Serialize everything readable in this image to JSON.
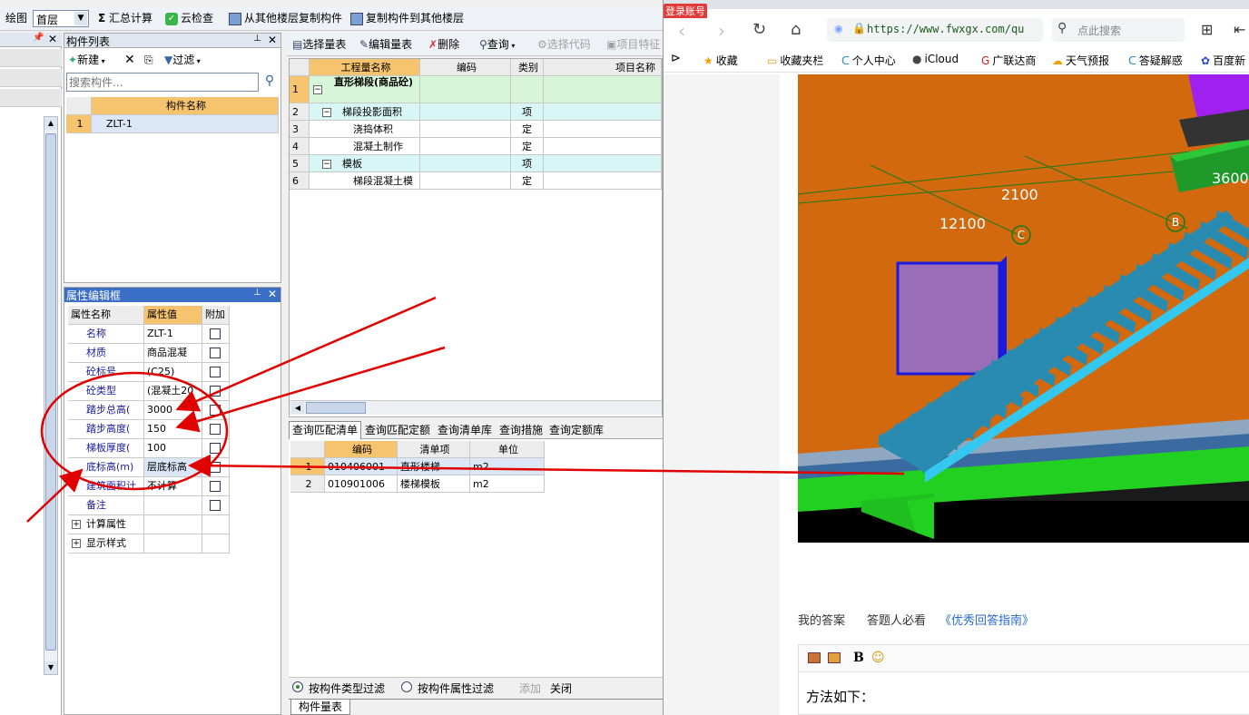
{
  "toolbar": {
    "draw_label": "绘图",
    "floor_value": "首层",
    "summary_calc": "汇总计算",
    "cloud_check": "云检查",
    "copy_from_floor": "从其他楼层复制构件",
    "copy_to_floor": "复制构件到其他楼层"
  },
  "component_list": {
    "title": "构件列表",
    "new_label": "新建",
    "filter_label": "过滤",
    "search_placeholder": "搜索构件...",
    "col_name": "构件名称",
    "rows": [
      {
        "idx": "1",
        "name": "ZLT-1"
      }
    ]
  },
  "property_editor": {
    "title": "属性编辑框",
    "col_name": "属性名称",
    "col_value": "属性值",
    "col_extra": "附加",
    "rows": [
      {
        "name": "名称",
        "value": "ZLT-1"
      },
      {
        "name": "材质",
        "value": "商品混凝"
      },
      {
        "name": "砼标号",
        "value": "(C25)"
      },
      {
        "name": "砼类型",
        "value": "(混凝土20"
      },
      {
        "name": "踏步总高(",
        "value": "3000"
      },
      {
        "name": "踏步高度(",
        "value": "150"
      },
      {
        "name": "梯板厚度(",
        "value": "100"
      },
      {
        "name": "底标高(m)",
        "value": "层底标高"
      },
      {
        "name": "建筑面积计",
        "value": "不计算"
      },
      {
        "name": "备注",
        "value": ""
      },
      {
        "name": "计算属性",
        "value": ""
      },
      {
        "name": "显示样式",
        "value": ""
      }
    ]
  },
  "quantity_toolbar": {
    "select_list": "选择量表",
    "edit_list": "编辑量表",
    "delete": "删除",
    "query": "查询",
    "select_code": "选择代码",
    "item_feature": "项目特征"
  },
  "quantity_table": {
    "cols": [
      "工程量名称",
      "编码",
      "类别",
      "项目名称"
    ],
    "rows": [
      {
        "idx": "1",
        "name": "直形梯段(商品砼)",
        "code": "",
        "type": ""
      },
      {
        "idx": "2",
        "name": "梯段投影面积",
        "code": "",
        "type": "项"
      },
      {
        "idx": "3",
        "name": "浇捣体积",
        "code": "",
        "type": "定"
      },
      {
        "idx": "4",
        "name": "混凝土制作",
        "code": "",
        "type": "定"
      },
      {
        "idx": "5",
        "name": "模板",
        "code": "",
        "type": "项"
      },
      {
        "idx": "6",
        "name": "梯段混凝土模",
        "code": "",
        "type": "定"
      }
    ]
  },
  "query_tabs": [
    "查询匹配清单",
    "查询匹配定额",
    "查询清单库",
    "查询措施",
    "查询定额库"
  ],
  "match_table": {
    "cols": [
      "编码",
      "清单项",
      "单位"
    ],
    "rows": [
      {
        "idx": "1",
        "code": "010406001",
        "item": "直形楼梯",
        "unit": "m2"
      },
      {
        "idx": "2",
        "code": "010901006",
        "item": "楼梯模板",
        "unit": "m2"
      }
    ]
  },
  "filter_bar": {
    "by_type": "按构件类型过滤",
    "by_attr": "按构件属性过滤",
    "add": "添加",
    "close": "关闭"
  },
  "bottom_tab": "构件量表",
  "browser": {
    "login_badge": "登录账号",
    "url": "https://www.fwxgx.com/qu",
    "search_placeholder": "点此搜索",
    "bookmarks": [
      "收藏",
      "收藏夹栏",
      "个人中心",
      "iCloud",
      "广联达商",
      "天气预报",
      "答疑解惑",
      "百度新"
    ],
    "scene_labels": {
      "dim_a": "2100",
      "dim_b": "12100",
      "dim_c": "3600",
      "axis_c": "C",
      "axis_b": "B"
    },
    "answer_links": {
      "my_answer": "我的答案",
      "must_read": "答题人必看",
      "guide": "《优秀回答指南》"
    },
    "editor_bold": "B",
    "editor_text": "方法如下："
  },
  "colors": {
    "orange_header": "#f6c36e",
    "panel_title": "#3b6fc6",
    "cyan_row": "#d8f6f6",
    "green_row": "#d7f5d7",
    "accent_red": "#e00000"
  }
}
